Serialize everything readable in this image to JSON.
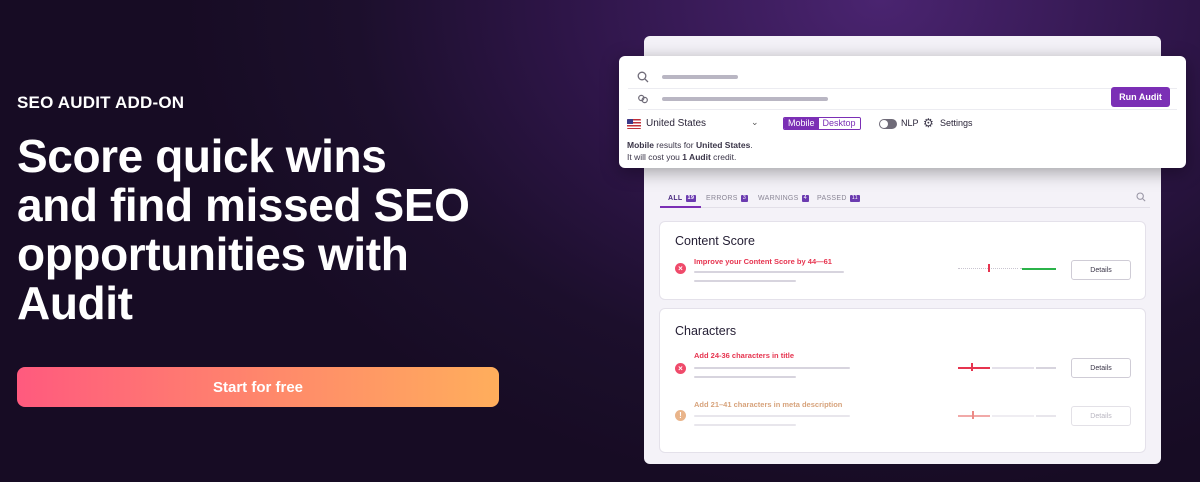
{
  "hero": {
    "eyebrow": "SEO AUDIT ADD-ON",
    "headline": "Score quick wins and find missed SEO opportunities with Audit",
    "cta_label": "Start for free"
  },
  "audit_form": {
    "run_label": "Run Audit",
    "country": "United States",
    "device_options": [
      "Mobile",
      "Desktop"
    ],
    "device_selected": "Mobile",
    "nlp_label": "NLP",
    "settings_label": "Settings",
    "note": {
      "device": "Mobile",
      "results_for": "results for",
      "country": "United States",
      "period": ".",
      "cost_prefix": "It will cost you",
      "cost_amount": "1 Audit",
      "cost_suffix": "credit."
    }
  },
  "tabs": [
    {
      "label": "ALL",
      "count": "19"
    },
    {
      "label": "ERRORS",
      "count": "3"
    },
    {
      "label": "WARNINGS",
      "count": "4"
    },
    {
      "label": "PASSED",
      "count": "11"
    }
  ],
  "sections": [
    {
      "title": "Content Score",
      "issues": [
        {
          "title": "Improve your Content Score by 44—61",
          "type": "error",
          "details_label": "Details"
        }
      ]
    },
    {
      "title": "Characters",
      "issues": [
        {
          "title": "Add 24-36 characters in title",
          "type": "error",
          "details_label": "Details"
        },
        {
          "title": "Add 21–41 characters in meta description",
          "type": "warning",
          "details_label": "Details"
        }
      ]
    }
  ],
  "colors": {
    "accent": "#7b2fb5",
    "error": "#e6344f",
    "success": "#2bb34a",
    "cta_start": "#ff5a7e",
    "cta_end": "#ffae5c"
  }
}
